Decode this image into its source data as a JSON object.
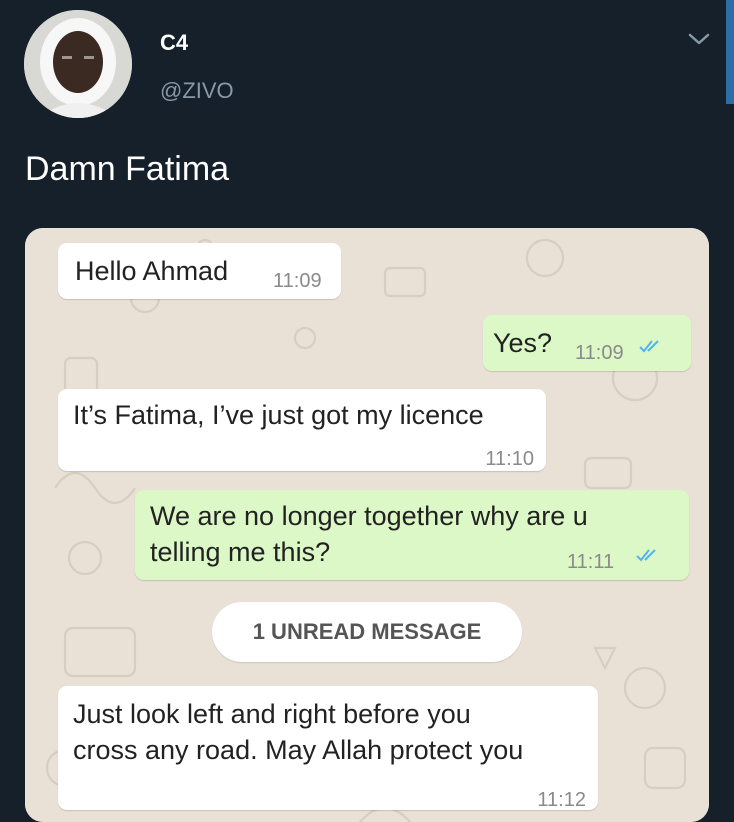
{
  "tweet": {
    "display_name": "C4",
    "handle": "@ZIVO",
    "text": "Damn Fatima"
  },
  "chat": {
    "messages": [
      {
        "direction": "incoming",
        "text": "Hello Ahmad",
        "time": "11:09"
      },
      {
        "direction": "outgoing",
        "text": "Yes?",
        "time": "11:09"
      },
      {
        "direction": "incoming",
        "text": "It’s Fatima, I’ve just got my licence",
        "time": "11:10"
      },
      {
        "direction": "outgoing",
        "line1": "We are no longer together why are u",
        "line2": "telling me this?",
        "time": "11:11"
      },
      {
        "direction": "incoming",
        "line1": "Just look left and right before you",
        "line2": "cross any road. May Allah protect you",
        "time": "11:12"
      }
    ],
    "unread_label": "1 UNREAD MESSAGE"
  },
  "colors": {
    "background": "#15202b",
    "incoming_bubble": "#ffffff",
    "outgoing_bubble": "#dcf8c6",
    "read_ticks": "#4fb6ec",
    "chat_wallpaper": "#e9e1d6"
  },
  "icons": [
    "chevron-down-icon",
    "double-check-icon",
    "avatar"
  ]
}
